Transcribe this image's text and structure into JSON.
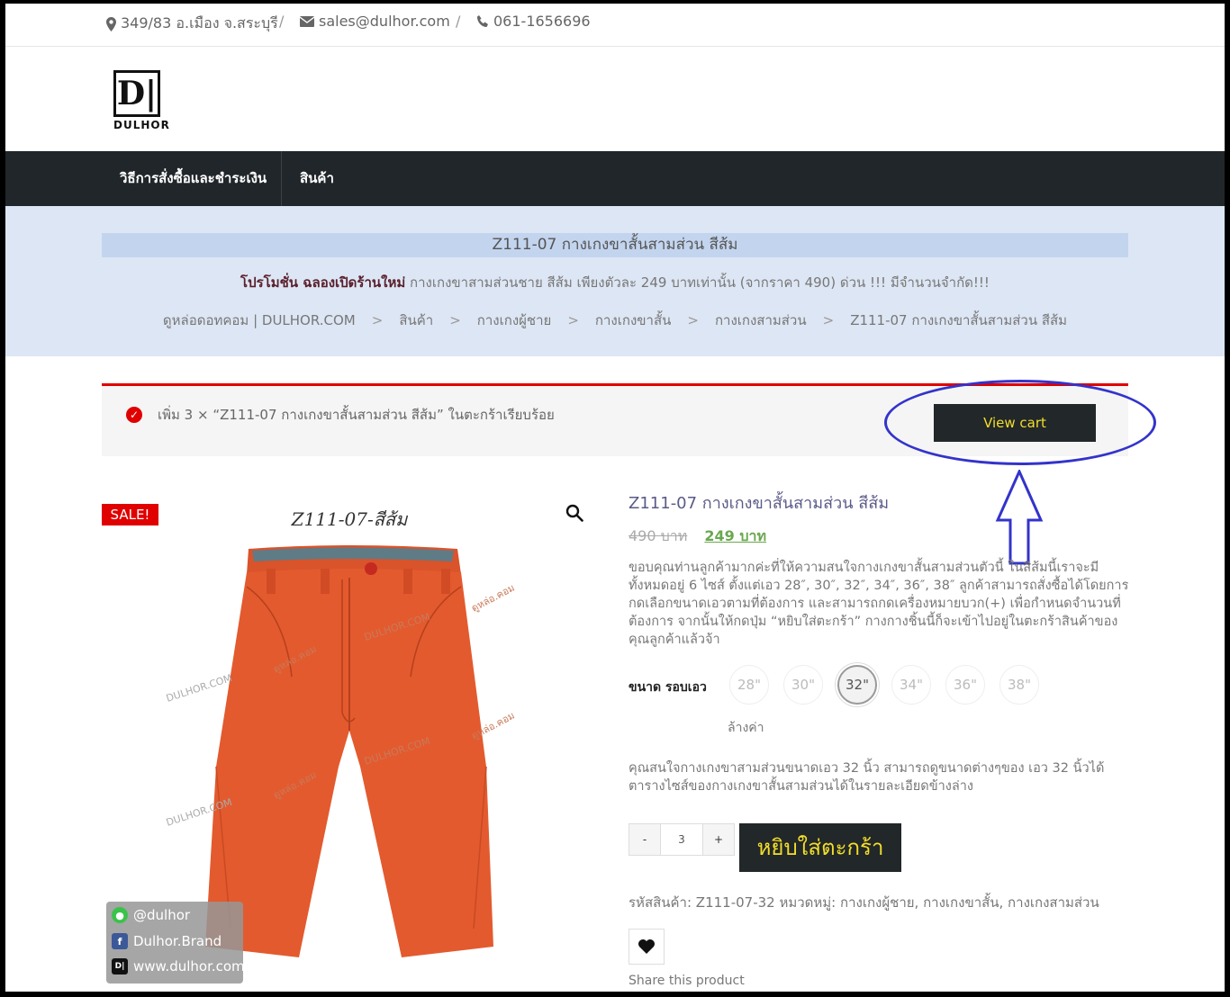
{
  "topbar": {
    "address": "349/83 อ.เมือง จ.สระบุรี",
    "email": "sales@dulhor.com",
    "phone": "061-1656696",
    "separator": "/"
  },
  "logo": {
    "mark": "D|",
    "word": "DULHOR"
  },
  "nav": {
    "items": [
      {
        "label": "วิธีการสั่งซื้อและชำระเงิน"
      },
      {
        "label": "สินค้า"
      }
    ]
  },
  "hero": {
    "title": "Z111-07 กางเกงขาสั้นสามส่วน สีส้ม",
    "promo_bold": "โปรโมชั่น ฉลองเปิดร้านใหม่",
    "promo_text": "กางเกงขาสามส่วนชาย สีส้ม เพียงตัวละ 249 บาทเท่านั้น (จากราคา 490) ด่วน !!! มีจำนวนจำกัด!!!",
    "breadcrumbs": [
      "ดูหล่อดอทคอม | DULHOR.COM",
      "สินค้า",
      "กางเกงผู้ชาย",
      "กางเกงขาสั้น",
      "กางเกงสามส่วน",
      "Z111-07 กางเกงขาสั้นสามส่วน สีส้ม"
    ]
  },
  "notice": {
    "message": "เพิ่ม 3 × “Z111-07 กางเกงขาสั้นสามส่วน สีส้ม” ในตะกร้าเรียบร้อย",
    "view_cart": "View cart"
  },
  "product": {
    "sale_badge": "SALE!",
    "image_caption": "Z111-07-สีส้ม",
    "watermark_1": "DULHOR.COM",
    "watermark_2": "ดูหล่อ.คอม",
    "title": "Z111-07 กางเกงขาสั้นสามส่วน สีส้ม",
    "old_price": "490 บาท",
    "new_price": "249 บาท",
    "description": "ขอบคุณท่านลูกค้ามากค่ะที่ให้ความสนใจกางเกงขาสั้นสามส่วนตัวนี้ ในสีส้มนี้เราจะมีทั้งหมดอยู่ 6 ไซส์ ตั้งแต่เอว 28″, 30″, 32″, 34″, 36″, 38″ ลูกค้าสามารถสั่งซื้อได้โดยการกดเลือกขนาดเอวตามที่ต้องการ และสามารถกดเครื่องหมายบวก(+) เพื่อกำหนดจำนวนที่ต้องการ จากนั้นให้กดปุ่ม “หยิบใส่ตะกร้า” กางกางชิ้นนี้ก็จะเข้าไปอยู่ในตะกร้าสินค้าของคุณลูกค้าแล้วจ้า",
    "size_label": "ขนาด รอบเอว",
    "sizes": [
      "28\"",
      "30\"",
      "32\"",
      "34\"",
      "36\"",
      "38\""
    ],
    "selected_size": "32\"",
    "clear_label": "ล้างค่า",
    "size_description": "คุณสนใจกางเกงขาสามส่วนขนาดเอว 32 นิ้ว สามารถดูขนาดต่างๆของ เอว 32 นิ้วได้ตารางไซส์ของกางเกงขาสั้นสามส่วนได้ในรายละเอียดข้างล่าง",
    "qty_minus": "-",
    "qty_value": "3",
    "qty_plus": "+",
    "add_to_cart": "หยิบใส่ตะกร้า",
    "meta": "รหัสสินค้า: Z111-07-32 หมวดหมู่: กางเกงผู้ชาย, กางเกงขาสั้น, กางเกงสามส่วน",
    "share_label": "Share this product"
  },
  "social": {
    "line": "@dulhor",
    "facebook": "Dulhor.Brand",
    "website": "www.dulhor.com"
  },
  "colors": {
    "nav_bg": "#20262a",
    "button_bg": "#222729",
    "button_text": "#f2de2a",
    "sale_red": "#e00000",
    "hero_bg": "#dde6f4",
    "annotation_blue": "#3333cc",
    "price_green": "#6aa84f"
  }
}
